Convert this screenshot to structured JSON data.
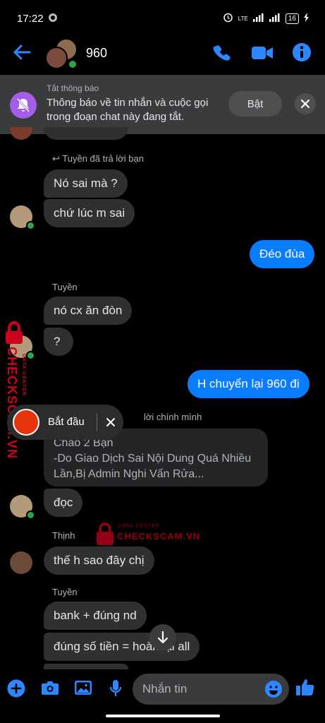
{
  "status_bar": {
    "time": "17:22",
    "network": "LTE",
    "battery": "16"
  },
  "header": {
    "title": "960"
  },
  "banner": {
    "title": "Tắt thông báo",
    "text": "Thông báo về tin nhắn và cuộc gọi trong đoạn chat này đang tắt.",
    "button": "Bật"
  },
  "messages": {
    "reply_note_1": "↩ Tuyền đã trả lời bạn",
    "m1": "Nó sai mà ?",
    "m2": "chứ lúc m sai",
    "m3": "Đéo đùa",
    "sender_tuyen_1": "Tuyền",
    "m4": "nó cx ăn đòn",
    "m5": "?",
    "m6": "H chuyển lại 960 đi",
    "reply_note_2": "lời chính mình",
    "quoted": "Chào 2 Bạn\n-Do Giao Dịch Sai Nội Dung Quá Nhiều Lần,Bị Admin Nghi Vấn Rửa...",
    "m7": "đọc",
    "sender_thinh": "Thịnh",
    "m8": "thế h sao đây chị",
    "sender_tuyen_2": "Tuyền",
    "m9": "bank + đúng nd",
    "m10": "đúng số tiền = hoàn lại all"
  },
  "recorder": {
    "label": "Bắt đầu"
  },
  "watermark": {
    "side": "CHECKSCAM.VN",
    "side_small": "DATA CENTER",
    "center_small": "DATA CENTER",
    "center": "CHECKSCAM.VN"
  },
  "composer": {
    "placeholder": "Nhắn tin"
  },
  "colors": {
    "accent": "#0a7cff",
    "banner_icon": "#a55eea",
    "online": "#31a24c"
  }
}
